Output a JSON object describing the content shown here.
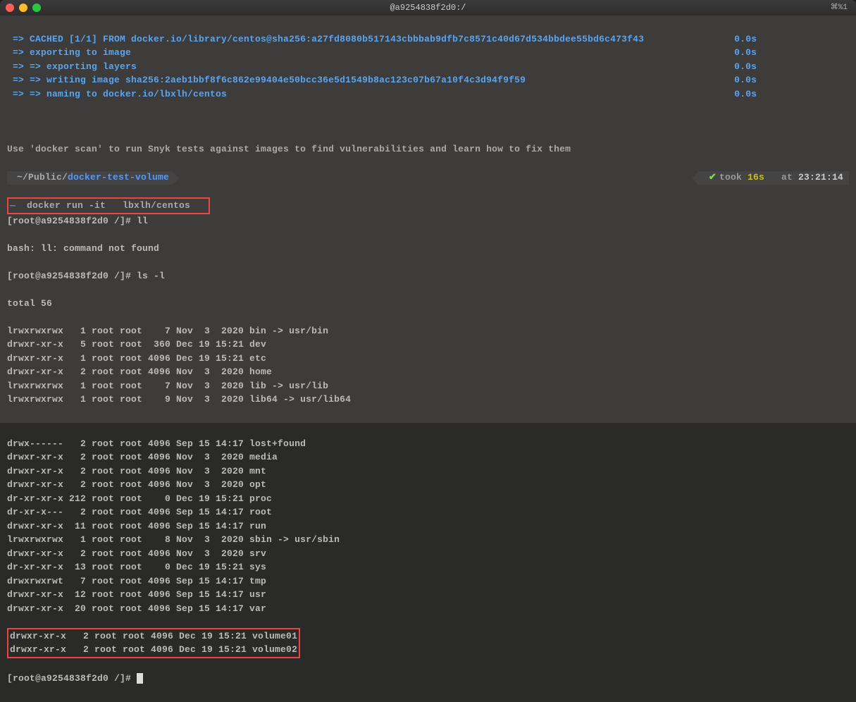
{
  "titlebar": {
    "title": "@a9254838f2d0:/",
    "shortcut": "⌘%1"
  },
  "docker_lines": [
    {
      "left": " => CACHED [1/1] FROM docker.io/library/centos@sha256:a27fd8080b517143cbbbab9dfb7c8571c40d67d534bbdee55bd6c473f43",
      "time": "0.0s"
    },
    {
      "left": " => exporting to image",
      "time": "0.0s"
    },
    {
      "left": " => => exporting layers",
      "time": "0.0s"
    },
    {
      "left": " => => writing image sha256:2aeb1bbf8f6c862e99404e50bcc36e5d1549b8ac123c07b67a10f4c3d94f9f59",
      "time": "0.0s"
    },
    {
      "left": " => => naming to docker.io/lbxlh/centos",
      "time": "0.0s"
    }
  ],
  "scan_hint": "Use 'docker scan' to run Snyk tests against images to find vulnerabilities and learn how to fix them",
  "status": {
    "path_prefix": "~/Public/",
    "path_dir": "docker-test-volume",
    "took_label": "took ",
    "took_val": "16s",
    "at_label": "   at ",
    "time": "23:21:14"
  },
  "run_cmd": "  docker run -it   lbxlh/centos   ",
  "prompts": {
    "p1": "[root@a9254838f2d0 /]# ",
    "cmd1": "ll",
    "err": "bash: ll: command not found",
    "p2": "[root@a9254838f2d0 /]# ",
    "cmd2": "ls -l",
    "total": "total 56",
    "final": "[root@a9254838f2d0 /]# "
  },
  "listing": [
    "lrwxrwxrwx   1 root root    7 Nov  3  2020 bin -> usr/bin",
    "drwxr-xr-x   5 root root  360 Dec 19 15:21 dev",
    "drwxr-xr-x   1 root root 4096 Dec 19 15:21 etc",
    "drwxr-xr-x   2 root root 4096 Nov  3  2020 home",
    "lrwxrwxrwx   1 root root    7 Nov  3  2020 lib -> usr/lib",
    "lrwxrwxrwx   1 root root    9 Nov  3  2020 lib64 -> usr/lib64",
    "drwx------   2 root root 4096 Sep 15 14:17 lost+found",
    "drwxr-xr-x   2 root root 4096 Nov  3  2020 media",
    "drwxr-xr-x   2 root root 4096 Nov  3  2020 mnt",
    "drwxr-xr-x   2 root root 4096 Nov  3  2020 opt",
    "dr-xr-xr-x 212 root root    0 Dec 19 15:21 proc",
    "dr-xr-x---   2 root root 4096 Sep 15 14:17 root",
    "drwxr-xr-x  11 root root 4096 Sep 15 14:17 run",
    "lrwxrwxrwx   1 root root    8 Nov  3  2020 sbin -> usr/sbin",
    "drwxr-xr-x   2 root root 4096 Nov  3  2020 srv",
    "dr-xr-xr-x  13 root root    0 Dec 19 15:21 sys",
    "drwxrwxrwt   7 root root 4096 Sep 15 14:17 tmp",
    "drwxr-xr-x  12 root root 4096 Sep 15 14:17 usr",
    "drwxr-xr-x  20 root root 4096 Sep 15 14:17 var"
  ],
  "volumes": [
    "drwxr-xr-x   2 root root 4096 Dec 19 15:21 volume01",
    "drwxr-xr-x   2 root root 4096 Dec 19 15:21 volume02"
  ]
}
